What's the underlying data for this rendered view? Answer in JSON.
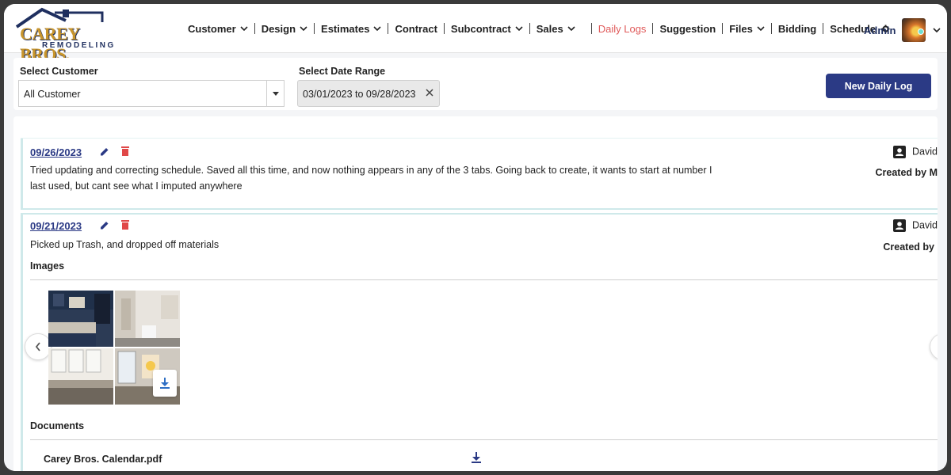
{
  "brand": {
    "name": "CAREY BROS.",
    "tagline": "REMODELING"
  },
  "nav": {
    "items": [
      {
        "label": "Customer",
        "dropdown": true
      },
      {
        "label": "Design",
        "dropdown": true
      },
      {
        "label": "Estimates",
        "dropdown": true
      },
      {
        "label": "Contract",
        "dropdown": false
      },
      {
        "label": "Subcontract",
        "dropdown": true
      },
      {
        "label": "Sales",
        "dropdown": true
      },
      {
        "label": "Daily Logs",
        "dropdown": false,
        "active": true
      },
      {
        "label": "Suggestion",
        "dropdown": false
      },
      {
        "label": "Files",
        "dropdown": true
      },
      {
        "label": "Bidding",
        "dropdown": false
      },
      {
        "label": "Schedule",
        "dropdown": false
      }
    ],
    "admin_label": "Admin"
  },
  "filters": {
    "customer_label": "Select Customer",
    "customer_value": "All Customer",
    "date_label": "Select Date Range",
    "date_value": "03/01/2023 to 09/28/2023",
    "new_button": "New Daily Log"
  },
  "logs": [
    {
      "date": "09/26/2023",
      "text": "Tried updating and correcting schedule. Saved all this time, and now nothing appears in any of the 3 tabs. Going back to create, it wants to start at number I last used, but cant see what I imputed anywhere",
      "user": "David",
      "created_by": "Created by M"
    },
    {
      "date": "09/21/2023",
      "text": "Picked up Trash, and dropped off materials",
      "user": "David",
      "created_by": "Created by",
      "images_title": "Images",
      "documents_title": "Documents",
      "documents": [
        {
          "name": "Carey Bros. Calendar.pdf"
        }
      ]
    }
  ],
  "colors": {
    "primary": "#2b3a85",
    "active_nav": "#e05a5a",
    "delete": "#e04848",
    "accent_border": "#cfe9ea"
  }
}
